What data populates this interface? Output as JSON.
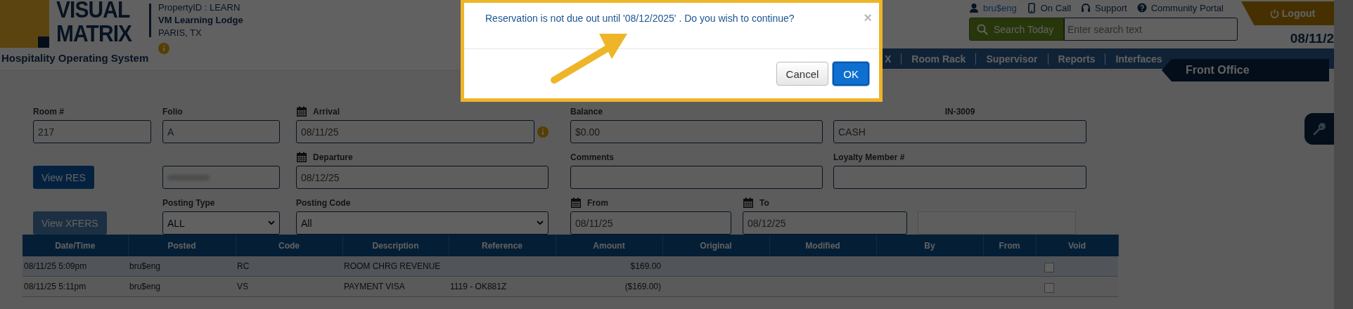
{
  "header": {
    "logo_line1": "VISUAL",
    "logo_line2": "MATRIX",
    "tagline": "Hospitality Operating System",
    "property_id": "PropertyID : LEARN",
    "property_name": "VM Learning Lodge",
    "property_location": "PARIS, TX",
    "user_links": [
      {
        "kind": "user",
        "label": "bru$eng"
      },
      {
        "kind": "phone",
        "label": "On Call"
      },
      {
        "kind": "headset",
        "label": "Support"
      },
      {
        "kind": "help",
        "label": "Community Portal"
      }
    ],
    "search_button": "Search Today",
    "search": {
      "placeholder": "Enter search text"
    },
    "logout": "Logout",
    "date": "08/11/2"
  },
  "nav": {
    "items": [
      "X",
      "Room Rack",
      "Supervisor",
      "Reports",
      "Interfaces"
    ],
    "module": "Front Office"
  },
  "form": {
    "rows": [
      [
        {
          "kind": "input",
          "label": "Room #",
          "value": "217"
        },
        {
          "kind": "input",
          "label": "Folio",
          "value": "A"
        },
        {
          "kind": "input",
          "label": "Arrival",
          "calendar": true,
          "info": true,
          "value": "08/11/25"
        },
        {
          "kind": "input",
          "label": "Balance",
          "value": "$0.00"
        },
        {
          "kind": "input",
          "label": "IN-3009",
          "centered": true,
          "value": "CASH"
        }
      ],
      [
        {
          "kind": "button",
          "label": "View RES",
          "disabled": false
        },
        {
          "kind": "blurred"
        },
        {
          "kind": "input",
          "label": "Departure",
          "calendar": true,
          "value": "08/12/25"
        },
        {
          "kind": "input",
          "label": "Comments"
        },
        {
          "kind": "input",
          "label": "Loyalty Member #"
        }
      ],
      [
        {
          "kind": "button",
          "label": "View XFERS",
          "disabled": true
        },
        {
          "kind": "select",
          "label": "Posting Type",
          "value": "ALL"
        },
        {
          "kind": "select",
          "label": "Posting Code",
          "value": "All"
        },
        {
          "kind": "input",
          "label": "From",
          "calendar": true,
          "value": "08/11/25"
        },
        {
          "kind": "input",
          "label": "To",
          "calendar": true,
          "value": "08/12/25"
        },
        {
          "kind": "plain"
        }
      ]
    ]
  },
  "table": {
    "columns": [
      "Date/Time",
      "Posted",
      "Code",
      "Description",
      "Reference",
      "Amount",
      "Original",
      "Modified",
      "By",
      "From",
      "Void"
    ],
    "rows": [
      {
        "cells": [
          "08/11/25 5:09pm",
          "bru$eng",
          "RC",
          "ROOM CHRG REVENUE",
          "",
          "$169.00",
          "",
          "",
          "",
          ""
        ],
        "void_checked": false
      },
      {
        "cells": [
          "08/11/25 5:11pm",
          "bru$eng",
          "VS",
          "PAYMENT VISA",
          "1119 - OK881Z",
          "($169.00)",
          "",
          "",
          "",
          ""
        ],
        "void_checked": false
      }
    ]
  },
  "modal": {
    "message": "Reservation is not due out until '08/12/2025' . Do you wish to continue?",
    "close": "×",
    "buttons": [
      {
        "kind": "default",
        "label": "Cancel"
      },
      {
        "kind": "primary",
        "label": "OK"
      }
    ]
  }
}
